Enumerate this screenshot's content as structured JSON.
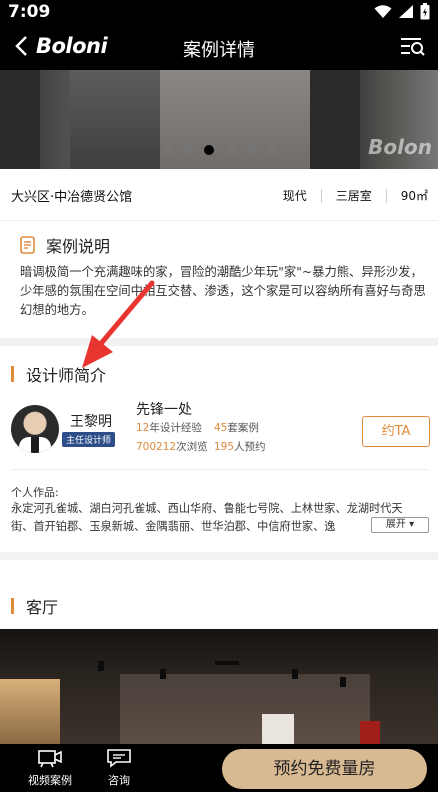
{
  "status_bar": {
    "time": "7:09"
  },
  "header": {
    "brand": "Boloni",
    "title": "案例详情"
  },
  "banner": {
    "watermark": "Bolon",
    "dot_count": 6,
    "active_dot": 2
  },
  "info": {
    "location": "大兴区·中冶德贤公馆",
    "style": "现代",
    "rooms": "三居室",
    "area": "90㎡"
  },
  "description": {
    "title": "案例说明",
    "text": "暗调极简一个充满趣味的家，冒险的潮酷少年玩\"家\"~暴力熊、异形沙发，少年感的氛围在空间中相互交替、渗透，这个家是可以容纳所有喜好与奇思幻想的地方。"
  },
  "designer_section": {
    "title": "设计师简介",
    "name": "王黎明",
    "badge": "主任设计师",
    "slogan": "先锋一处",
    "years": "12",
    "years_label": "年设计经验",
    "cases": "45",
    "cases_label": "套案例",
    "views": "700212",
    "views_label": "次浏览",
    "appointments": "195",
    "appointments_label": "人预约",
    "book_button": "约TA",
    "works_label": "个人作品:",
    "works_text": "永定河孔雀城、湖白河孔雀城、西山华府、鲁能七号院、上林世家、龙湖时代天街、首开铂郡、玉泉新城、金隅翡丽、世华泊郡、中信府世家、逸",
    "expand_button": "展开"
  },
  "living_room": {
    "title": "客厅"
  },
  "bottom_bar": {
    "video_label": "视频案例",
    "consult_label": "咨询",
    "cta": "预约免费量房"
  }
}
